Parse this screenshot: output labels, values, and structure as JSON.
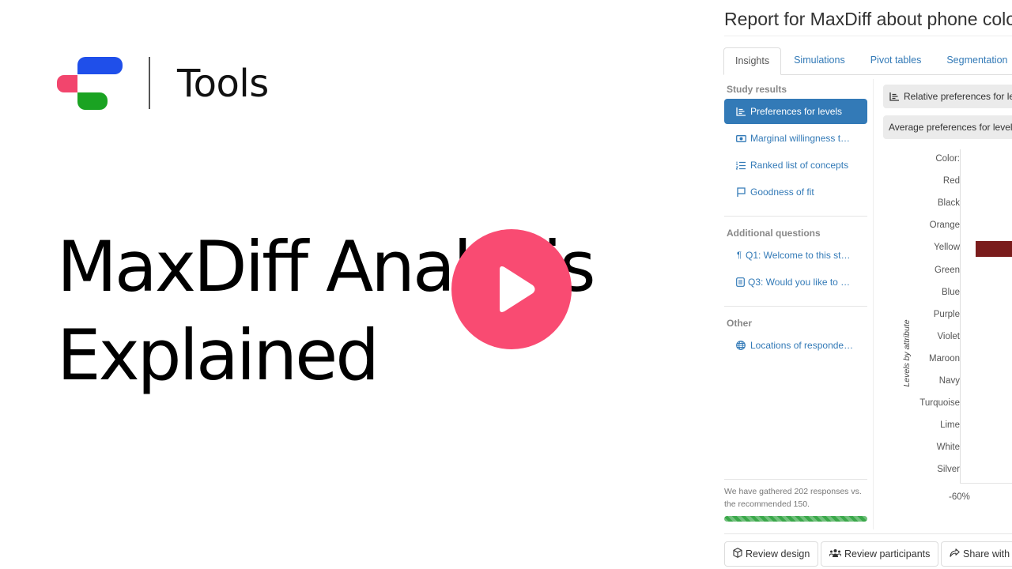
{
  "brand": {
    "section_label": "Tools",
    "logo_colors": {
      "blue": "#1f4fea",
      "pink": "#f2456d",
      "green": "#1aa322"
    }
  },
  "hero": {
    "title": "MaxDiff Analysis\nExplained",
    "play_icon": "play-icon",
    "play_color": "#f94b72"
  },
  "report": {
    "title": "Report for MaxDiff about phone colors",
    "tabs": [
      {
        "label": "Insights",
        "active": true
      },
      {
        "label": "Simulations",
        "active": false
      },
      {
        "label": "Pivot tables",
        "active": false
      },
      {
        "label": "Segmentation",
        "active": false
      }
    ],
    "sidebar": {
      "sections": [
        {
          "heading": "Study results",
          "items": [
            {
              "label": "Preferences for levels",
              "icon": "bar-chart-icon",
              "active": true
            },
            {
              "label": "Marginal willingness t…",
              "icon": "money-icon",
              "active": false
            },
            {
              "label": "Ranked list of concepts",
              "icon": "numbered-list-icon",
              "active": false
            },
            {
              "label": "Goodness of fit",
              "icon": "flag-icon",
              "active": false
            }
          ]
        },
        {
          "heading": "Additional questions",
          "items": [
            {
              "label": "Q1: Welcome to this st…",
              "icon": "paragraph-icon",
              "active": false
            },
            {
              "label": "Q3: Would you like to …",
              "icon": "form-icon",
              "active": false
            }
          ]
        },
        {
          "heading": "Other",
          "items": [
            {
              "label": "Locations of responde…",
              "icon": "globe-icon",
              "active": false
            }
          ]
        }
      ],
      "responses_note": "We have gathered 202 responses vs. the recommended 150.",
      "responses_gathered": 202,
      "responses_recommended": 150,
      "progress_percent": 100
    },
    "content": {
      "chips": [
        {
          "label": "Relative preferences for levels",
          "icon": "bar-chart-icon"
        },
        {
          "label": "Average preferences for levels"
        }
      ]
    },
    "footer_buttons": [
      {
        "label": "Review design",
        "icon": "cube-icon"
      },
      {
        "label": "Review participants",
        "icon": "users-icon"
      },
      {
        "label": "Share with others",
        "icon": "share-icon"
      }
    ]
  },
  "chart_data": {
    "type": "bar",
    "orientation": "horizontal",
    "ylabel": "Levels by attribute",
    "categories": [
      "Color:",
      "Red",
      "Black",
      "Orange",
      "Yellow",
      "Green",
      "Blue",
      "Purple",
      "Violet",
      "Maroon",
      "Navy",
      "Turquoise",
      "Lime",
      "White",
      "Silver"
    ],
    "visible_bars": [
      {
        "category": "Yellow",
        "value_start": -57,
        "color": "#7a1c1c"
      }
    ],
    "x_tick_labels": [
      "-60%"
    ],
    "xlim_visible": [
      -60,
      -50
    ]
  }
}
